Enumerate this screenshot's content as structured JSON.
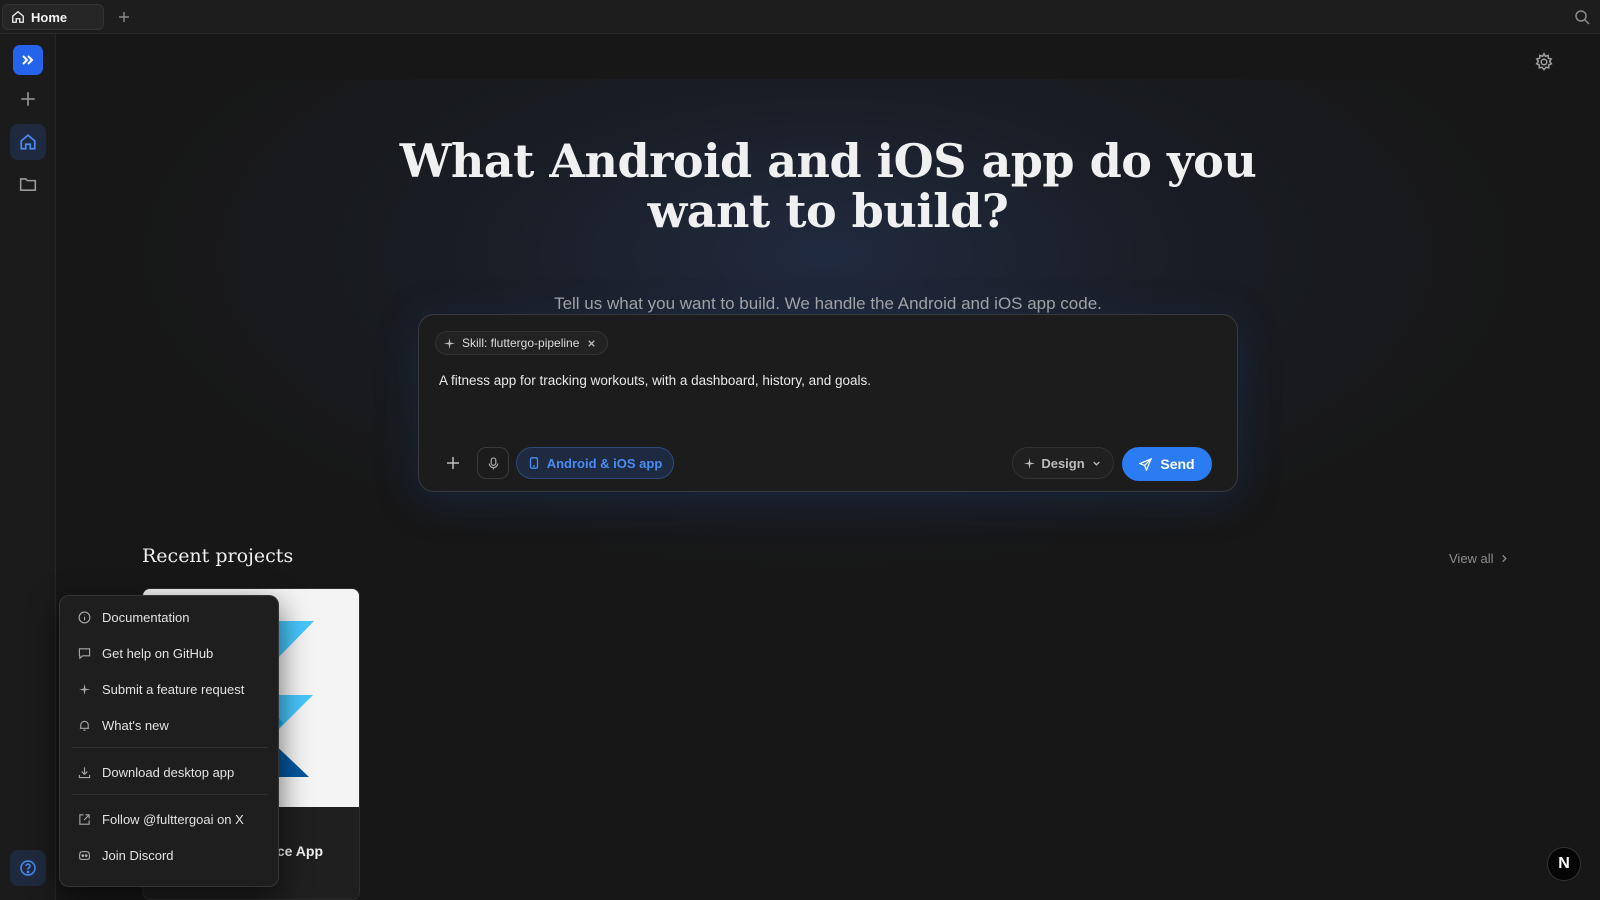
{
  "tabbar": {
    "home_tab": "Home"
  },
  "hero": {
    "title_line1": "What Android and iOS app do you",
    "title_line2": "want to build?",
    "subtitle": "Tell us what you want to build. We handle the Android and iOS app code."
  },
  "composer": {
    "skill_chip": "Skill: fluttergo-pipeline",
    "prompt": "A fitness app for tracking workouts, with a dashboard, history, and goals.",
    "platform_label": "Android & iOS app",
    "design_label": "Design",
    "send_label": "Send"
  },
  "recent": {
    "title": "Recent projects",
    "view_all": "View all",
    "projects": [
      {
        "title_visible": "ce App"
      }
    ]
  },
  "help_menu": {
    "items": [
      {
        "label": "Documentation",
        "icon": "info-icon"
      },
      {
        "label": "Get help on GitHub",
        "icon": "chat-icon"
      },
      {
        "label": "Submit a feature request",
        "icon": "sparkle-icon"
      },
      {
        "label": "What's new",
        "icon": "bell-icon"
      },
      {
        "label": "Download desktop app",
        "icon": "download-icon"
      },
      {
        "label": "Follow @fulttergoai on X",
        "icon": "external-link-icon"
      },
      {
        "label": "Join Discord",
        "icon": "discord-icon"
      }
    ]
  },
  "user": {
    "avatar_initial": "N"
  },
  "colors": {
    "accent": "#2b7bf2",
    "background": "#171717",
    "sidebar_active": "#1f2a3e"
  }
}
